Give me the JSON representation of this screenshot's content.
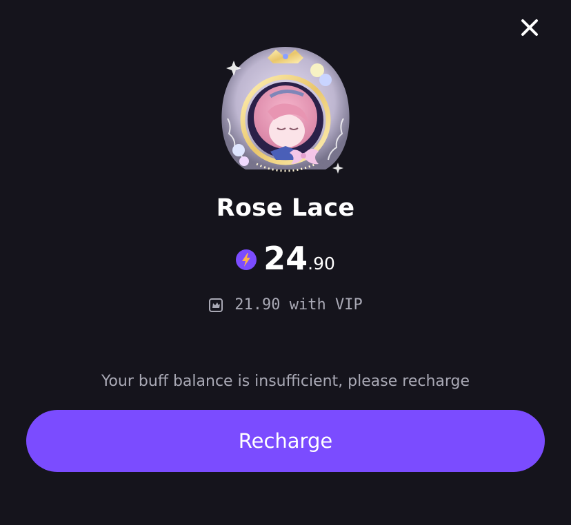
{
  "icons": {
    "close": "close-icon",
    "coin": "lightning-coin-icon",
    "vip": "vip-crown-icon",
    "avatar": "avatar-frame-image"
  },
  "item": {
    "name": "Rose Lace",
    "price_int": "24",
    "price_dec": ".90",
    "vip_price_text": "21.90 with VIP"
  },
  "notice": "Your buff balance is insufficient, please recharge",
  "recharge": {
    "label": "Recharge"
  },
  "colors": {
    "background": "#15141c",
    "accent": "#7b4cff",
    "muted_text": "#a9a9b5"
  }
}
